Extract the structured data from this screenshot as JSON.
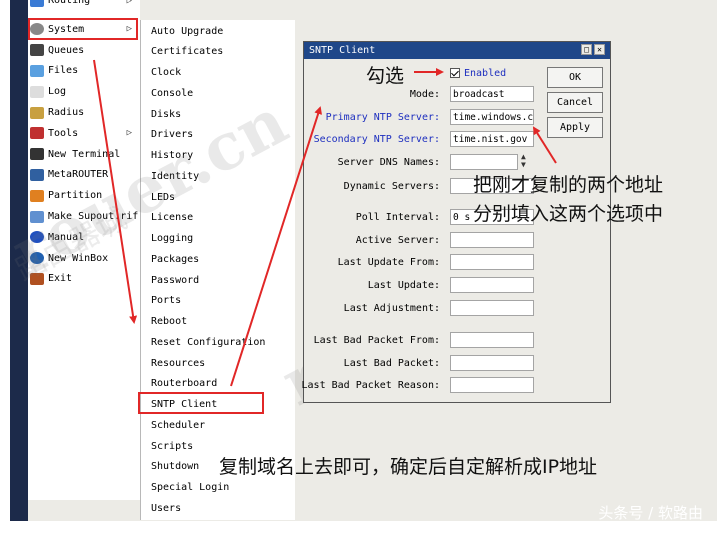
{
  "left_menu": {
    "items": [
      {
        "label": "Routing",
        "icon": "routing-icon",
        "submenu": true
      },
      {
        "label": "System",
        "icon": "gear-icon",
        "submenu": true
      },
      {
        "label": "Queues",
        "icon": "queues-icon"
      },
      {
        "label": "Files",
        "icon": "folder-icon"
      },
      {
        "label": "Log",
        "icon": "log-icon"
      },
      {
        "label": "Radius",
        "icon": "users-icon"
      },
      {
        "label": "Tools",
        "icon": "tools-icon",
        "submenu": true
      },
      {
        "label": "New Terminal",
        "icon": "terminal-icon"
      },
      {
        "label": "MetaROUTER",
        "icon": "metarouter-icon"
      },
      {
        "label": "Partition",
        "icon": "partition-icon"
      },
      {
        "label": "Make Supout.rif",
        "icon": "supout-icon"
      },
      {
        "label": "Manual",
        "icon": "help-icon"
      },
      {
        "label": "New WinBox",
        "icon": "globe-icon"
      },
      {
        "label": "Exit",
        "icon": "exit-icon"
      }
    ]
  },
  "system_submenu": {
    "items": [
      "Auto Upgrade",
      "Certificates",
      "Clock",
      "Console",
      "Disks",
      "Drivers",
      "History",
      "Identity",
      "LEDs",
      "License",
      "Logging",
      "Packages",
      "Password",
      "Ports",
      "Reboot",
      "Reset Configuration",
      "Resources",
      "Routerboard",
      "SNTP Client",
      "Scheduler",
      "Scripts",
      "Shutdown",
      "Special Login",
      "Users"
    ]
  },
  "dialog": {
    "title": "SNTP Client",
    "enabled_label": "Enabled",
    "enabled_checked": true,
    "mode_label": "Mode:",
    "mode_value": "broadcast",
    "primary_label": "Primary NTP Server:",
    "primary_value": "time.windows.c",
    "secondary_label": "Secondary NTP Server:",
    "secondary_value": "time.nist.gov",
    "dns_label": "Server DNS Names:",
    "dynamic_label": "Dynamic Servers:",
    "poll_label": "Poll Interval:",
    "poll_value": "0 s",
    "active_label": "Active Server:",
    "last_update_from_label": "Last Update From:",
    "last_update_label": "Last Update:",
    "last_adjustment_label": "Last Adjustment:",
    "last_bad_from_label": "Last Bad Packet From:",
    "last_bad_label": "Last Bad Packet:",
    "last_bad_reason_label": "Last Bad Packet Reason:",
    "ok_label": "OK",
    "cancel_label": "Cancel",
    "apply_label": "Apply"
  },
  "annotations": {
    "check": "勾选",
    "fill_line1": "把刚才复制的两个地址",
    "fill_line2": "分别填入这两个选项中",
    "bottom": "复制域名上去即可，确定后自定解析成IP地址",
    "watermark_bottom": "头条号 / 软路由",
    "watermark_1": "rouer.cn",
    "watermark_2": "rouer.cn",
    "watermark_3": "路由老卖",
    "watermark_4": "路由器城"
  },
  "colors": {
    "highlight": "#e12727",
    "titlebar": "#1f4789",
    "blue_label": "#1e2fbf"
  }
}
